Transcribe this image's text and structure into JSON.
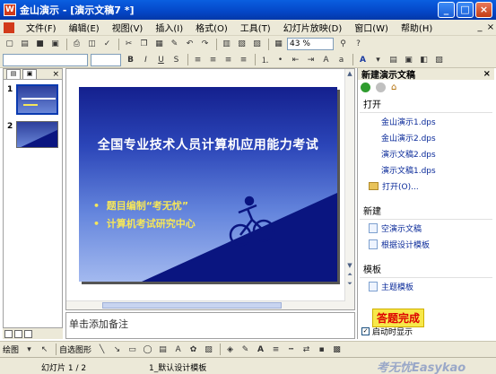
{
  "window": {
    "title": "金山演示 - [演示文稿7 *]",
    "app_icon": "wps-presentation-icon"
  },
  "menu": [
    "文件(F)",
    "编辑(E)",
    "视图(V)",
    "插入(I)",
    "格式(O)",
    "工具(T)",
    "幻灯片放映(D)",
    "窗口(W)",
    "帮助(H)"
  ],
  "toolbar": {
    "zoom": "43 %"
  },
  "slides": {
    "numbers": [
      "1",
      "2"
    ],
    "current": {
      "title": "全国专业技术人员计算机应用能力考试",
      "bullets": [
        "题目编制“考无忧”",
        "计算机考试研究中心"
      ]
    }
  },
  "notes": {
    "placeholder": "单击添加备注"
  },
  "task_pane": {
    "title": "新建演示文稿",
    "open_section": "打开",
    "recent_files": [
      "金山演示1.dps",
      "金山演示2.dps",
      "演示文稿2.dps",
      "演示文稿1.dps"
    ],
    "open_more": "打开(O)...",
    "new_section": "新建",
    "new_items": [
      "空演示文稿",
      "根据设计模板"
    ],
    "template_section": "模板",
    "template_items": [
      "主题模板"
    ],
    "startup_label": "启动时显示"
  },
  "badge": "答题完成",
  "drawbar": {
    "draw_label": "绘图",
    "autoshape_label": "自选图形"
  },
  "status": {
    "slide_counter": "幻灯片 1 / 2",
    "template": "1_默认设计模板"
  },
  "watermark": "考无忧Easykao",
  "colors": {
    "title_bar": "#0446c7",
    "slide_top": "#14208e",
    "slide_bottom": "#a3b9ef",
    "bullet_text": "#f5e65a",
    "link": "#0b2b9a"
  }
}
